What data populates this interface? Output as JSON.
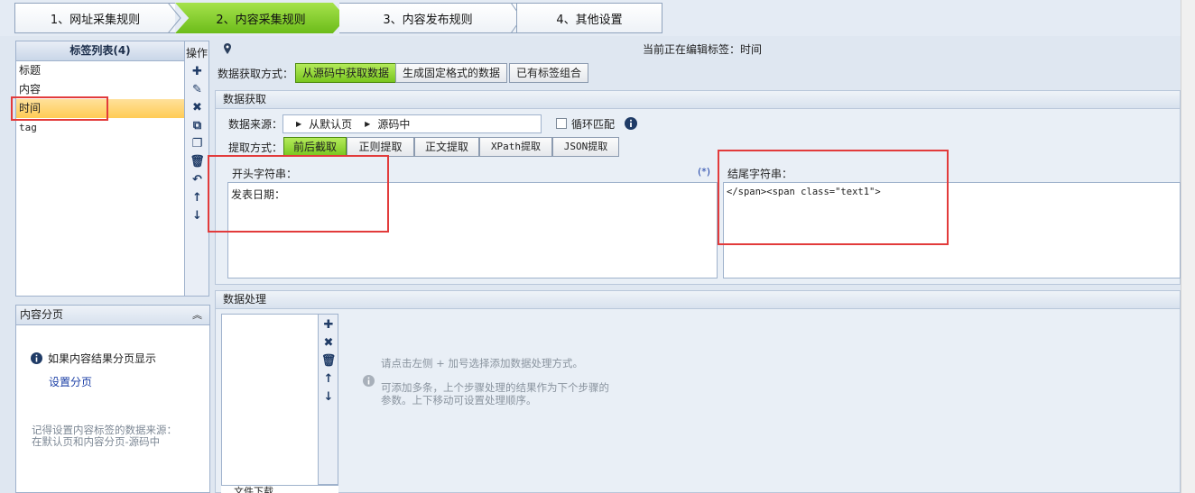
{
  "steps": [
    {
      "label": "1、网址采集规则"
    },
    {
      "label": "2、内容采集规则"
    },
    {
      "label": "3、内容发布规则"
    },
    {
      "label": "4、其他设置"
    }
  ],
  "tag_list": {
    "title": "标签列表(4)",
    "items": [
      {
        "label": "标题"
      },
      {
        "label": "内容"
      },
      {
        "label": "时间"
      },
      {
        "label": "tag"
      }
    ]
  },
  "ops": {
    "title": "操作",
    "icons": [
      "plus-icon",
      "pencil-icon",
      "close-icon",
      "copy-icon",
      "paste-icon",
      "trash-icon",
      "undo-icon",
      "arrow-up-icon",
      "arrow-down-icon"
    ]
  },
  "editing": {
    "label": "当前正在编辑标签：时间"
  },
  "fetch_mode": {
    "label": "数据获取方式：",
    "options": [
      "从源码中获取数据",
      "生成固定格式的数据",
      "已有标签组合"
    ]
  },
  "data_fetch": {
    "section_title": "数据获取",
    "source_label": "数据来源：",
    "source_path": [
      "从默认页",
      "源码中"
    ],
    "loop_label": "循环匹配",
    "extract_label": "提取方式：",
    "extract_options": [
      "前后截取",
      "正则提取",
      "正文提取",
      "XPath提取",
      "JSON提取"
    ],
    "start_label": "开头字符串：",
    "start_value": "发表日期：",
    "wildcard": "(*)",
    "end_label": "结尾字符串：",
    "end_value": "</span><span class=\"text1\">"
  },
  "processing": {
    "section_title": "数据处理",
    "hint1": "请点击左侧 + 加号选择添加数据处理方式。",
    "hint2a": "可添加多条，上个步骤处理的结果作为下个步骤的",
    "hint2b": "参数。上下移动可设置处理顺序。",
    "bottom_partial": "文件下载"
  },
  "pagination": {
    "title": "内容分页",
    "info": "如果内容结果分页显示",
    "link": "设置分页",
    "note1": "记得设置内容标签的数据来源：",
    "note2": "在默认页和内容分页-源码中"
  },
  "colors": {
    "active_green": "#78c61e",
    "selection_yellow": "#ffcc55",
    "annotation_red": "#e23b3b",
    "link_blue": "#1b3fa6"
  }
}
